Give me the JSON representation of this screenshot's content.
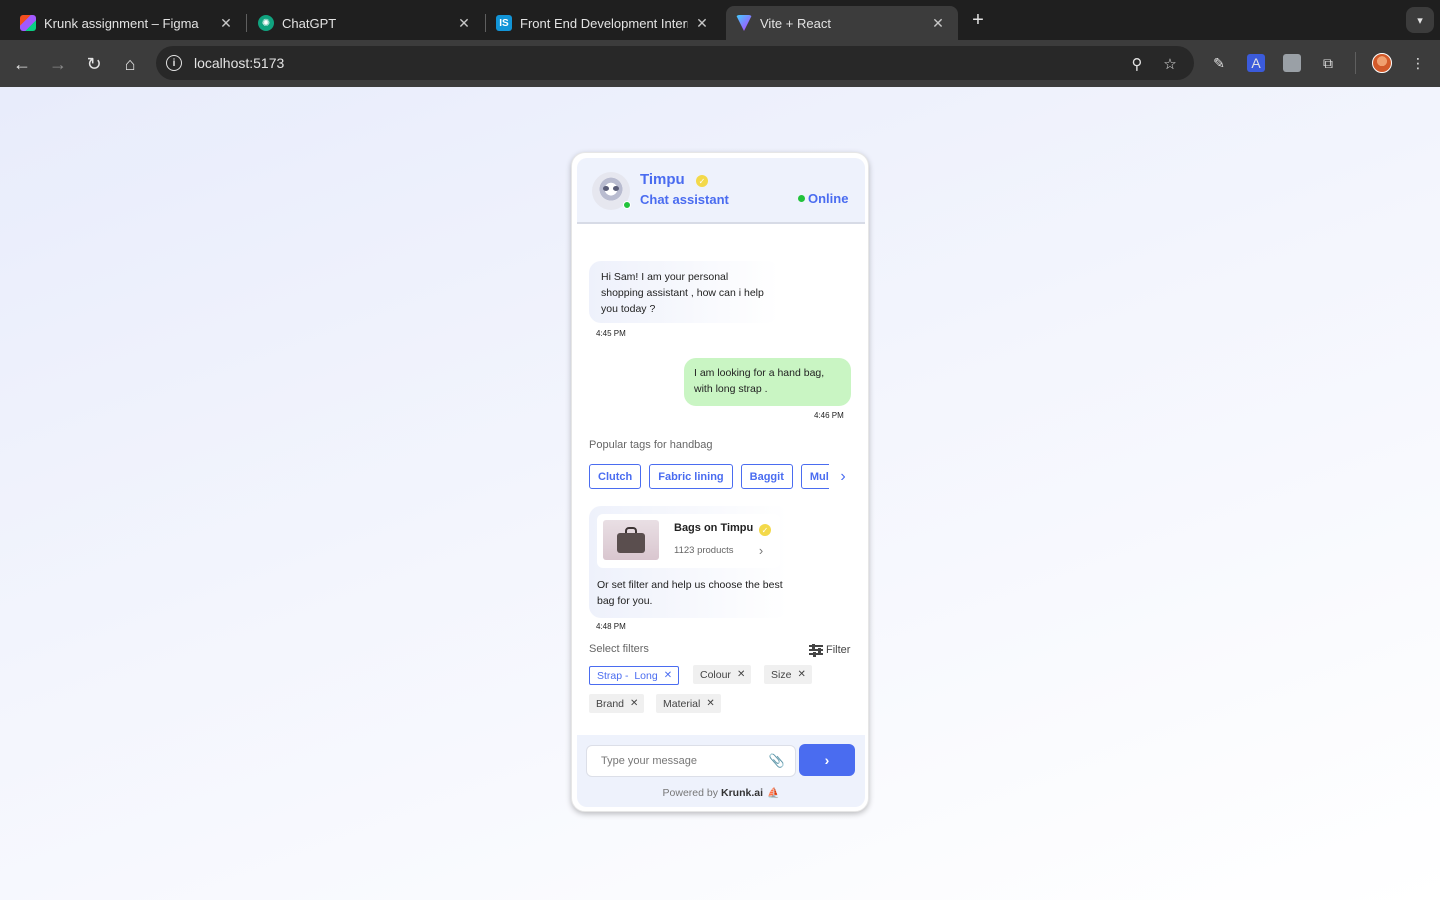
{
  "browser": {
    "tabs": [
      {
        "title": "Krunk assignment – Figma",
        "icon": "figma-icon"
      },
      {
        "title": "ChatGPT",
        "icon": "chatgpt-icon"
      },
      {
        "title": "Front End Development Intern",
        "icon": "internshala-icon"
      },
      {
        "title": "Vite + React",
        "icon": "vite-icon",
        "active": true
      }
    ],
    "new_tab": "+",
    "url": "localhost:5173"
  },
  "chat": {
    "header": {
      "name": "Timpu",
      "role": "Chat assistant",
      "status": "Online"
    },
    "messages": [
      {
        "from": "bot",
        "text": "Hi Sam! I am your personal shopping assistant , how can i help you today ?",
        "time": "4:45 PM"
      },
      {
        "from": "user",
        "text": "I am looking for a hand bag, with long strap .",
        "time": "4:46 PM"
      }
    ],
    "tags_label": "Popular tags for handbag",
    "tags": [
      "Clutch",
      "Fabric lining",
      "Baggit",
      "Multi"
    ],
    "product": {
      "title": "Bags on Timpu",
      "count": "1123 products",
      "text": "Or set filter and help us choose the best bag for you.",
      "time": "4:48 PM"
    },
    "filters_label": "Select filters",
    "filter_button": "Filter",
    "filters": [
      {
        "label": "Strap -  Long",
        "selected": true
      },
      {
        "label": "Colour",
        "selected": false
      },
      {
        "label": "Size",
        "selected": false
      },
      {
        "label": "Brand",
        "selected": false
      },
      {
        "label": "Material",
        "selected": false
      }
    ],
    "composer": {
      "placeholder": "Type your message",
      "powered_by": "Powered by",
      "brand": "Krunk.ai"
    }
  },
  "colors": {
    "accent": "#4a6cf0",
    "online": "#22c33b",
    "user_bubble": "#c9f5c3"
  }
}
